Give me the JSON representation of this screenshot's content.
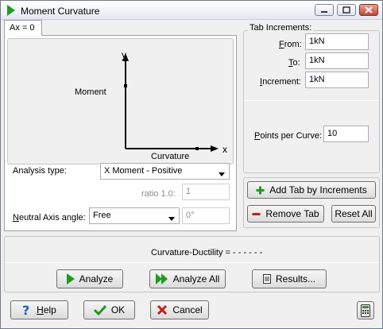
{
  "window": {
    "title": "Moment Curvature"
  },
  "tabs": [
    {
      "label": "Ax = 0"
    }
  ],
  "diagram": {
    "y_label": "y",
    "x_label": "x",
    "moment_label": "Moment",
    "curvature_label": "Curvature"
  },
  "analysis": {
    "type_label": "Analysis type:",
    "type_value": "X Moment - Positive",
    "ratio_label": "ratio 1.0:",
    "ratio_value": "1",
    "neutral_label_prefix": "N",
    "neutral_label_rest": "eutral Axis angle:",
    "neutral_value": "Free",
    "angle_value": "0°"
  },
  "increments": {
    "group_label": "Tab Increments:",
    "from_prefix": "F",
    "from_rest": "rom:",
    "from_value": "1kN",
    "to_prefix": "T",
    "to_rest": "o:",
    "to_value": "1kN",
    "increment_prefix": "I",
    "increment_rest": "ncrement:",
    "increment_value": "1kN",
    "points_prefix": "P",
    "points_rest": "oints per Curve:",
    "points_value": "10"
  },
  "tab_actions": {
    "add_label": "Add Tab by Increments",
    "remove_label": "Remove Tab",
    "reset_label": "Reset All"
  },
  "results": {
    "ductility_text": "Curvature-Ductility = - - - - - -"
  },
  "actions": {
    "analyze": "Analyze",
    "analyze_all": "Analyze All",
    "results": "Results..."
  },
  "footer": {
    "help_prefix": "H",
    "help_rest": "elp",
    "ok": "OK",
    "cancel": "Cancel"
  },
  "colors": {
    "accent_green": "#1e9a1e",
    "cancel_red": "#c0201a",
    "help_blue": "#1a5fc8"
  }
}
